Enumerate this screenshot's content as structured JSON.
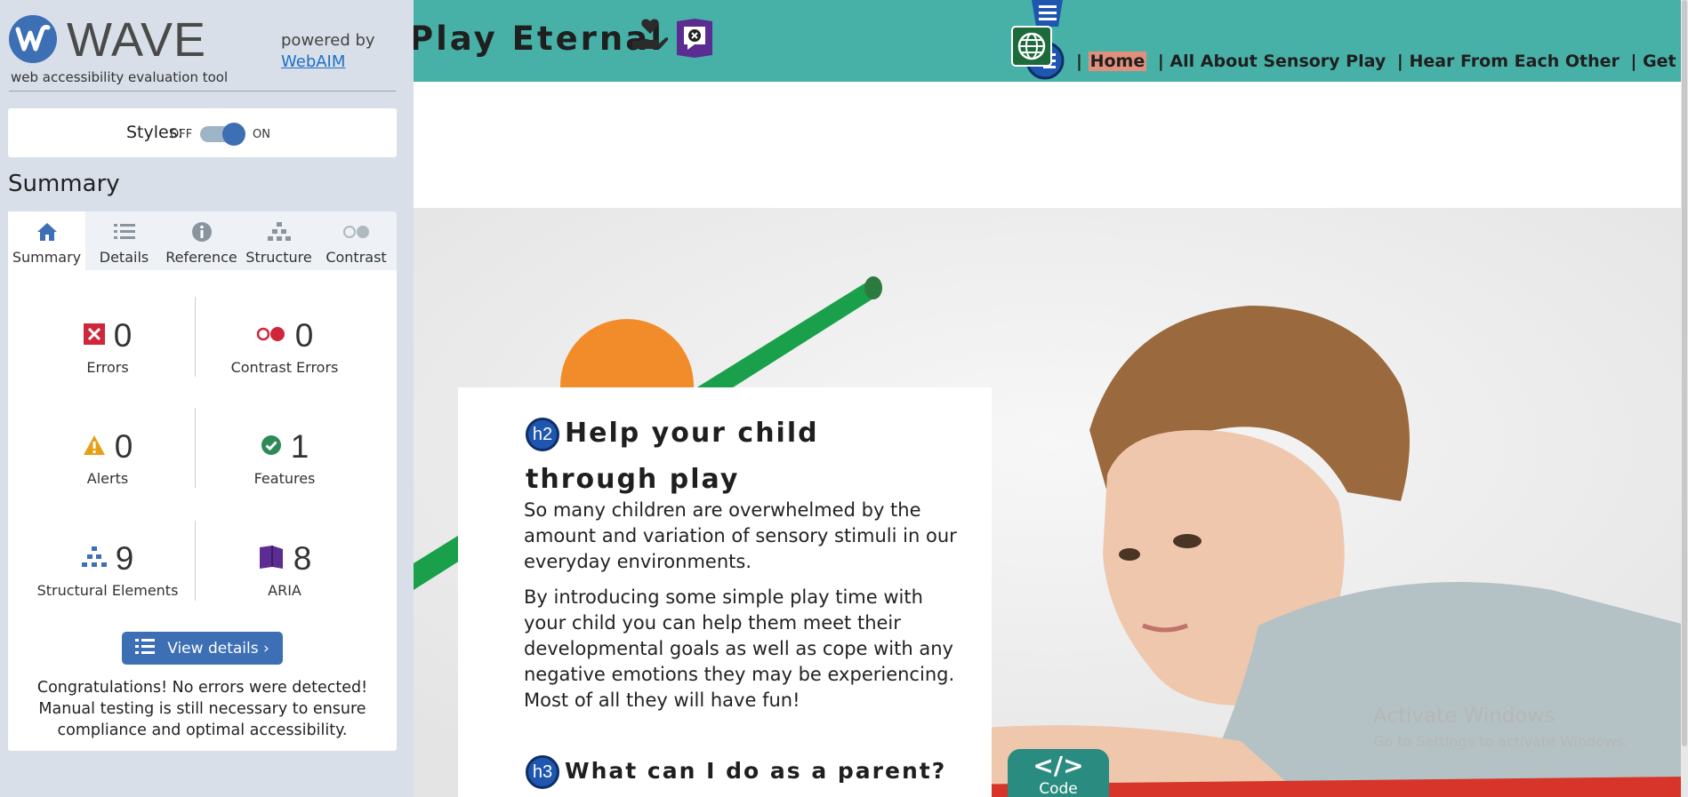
{
  "wave": {
    "logo_text": "WAVE",
    "tagline": "web accessibility evaluation tool",
    "powered_by": "powered by",
    "powered_link": "WebAIM",
    "styles_label": "Styles:",
    "styles_off": "OFF",
    "styles_on": "ON",
    "summary_title": "Summary",
    "tabs": [
      {
        "label": "Summary",
        "icon": "home-icon"
      },
      {
        "label": "Details",
        "icon": "list-icon"
      },
      {
        "label": "Reference",
        "icon": "info-icon"
      },
      {
        "label": "Structure",
        "icon": "hierarchy-icon"
      },
      {
        "label": "Contrast",
        "icon": "contrast-icon"
      }
    ],
    "stats": {
      "errors": {
        "value": "0",
        "label": "Errors"
      },
      "contrast_errors": {
        "value": "0",
        "label": "Contrast Errors"
      },
      "alerts": {
        "value": "0",
        "label": "Alerts"
      },
      "features": {
        "value": "1",
        "label": "Features"
      },
      "structural": {
        "value": "9",
        "label": "Structural Elements"
      },
      "aria": {
        "value": "8",
        "label": "ARIA"
      }
    },
    "view_details": "View details ›",
    "congrats": "Congratulations! No errors were detected! Manual testing is still necessary to ensure compliance and optimal accessibility.",
    "colors": {
      "accent": "#3d6fb5",
      "sidebar_bg": "#d8dfe8"
    }
  },
  "site": {
    "title": "Play Eternal",
    "nav": {
      "sep": "|",
      "home": "Home",
      "about": "All About Sensory Play",
      "hear": "Hear From Each Other",
      "contact": "Get In Touch"
    },
    "h2_badge": "h2",
    "h2_line1": "Help your child",
    "h2_line2": "through play",
    "para1": "So many children are overwhelmed by the amount and variation of sensory stimuli in our everyday environments.",
    "para2": "By introducing some simple play time with your child you can help them meet their developmental goals as well as cope with any negative emotions they may be experiencing. Most of all they will have fun!",
    "h3_badge": "h3",
    "h3_text": "What can I do as a parent?",
    "code_symbol": "</>",
    "code_label": "Code",
    "activate_title": "Activate Windows",
    "activate_sub": "Go to Settings to activate Windows.",
    "colors": {
      "header_bg": "#48b1a7",
      "home_highlight": "#e0907d"
    }
  }
}
